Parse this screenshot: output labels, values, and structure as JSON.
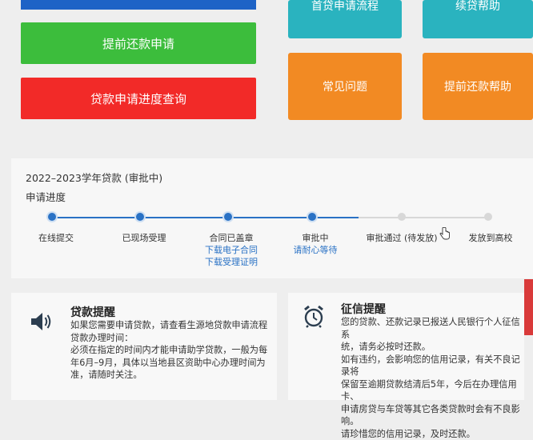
{
  "left_buttons": {
    "top_bar_color": "#1e63c6",
    "early_repay_apply": "提前还款申请",
    "early_repay_apply_color": "#3cbd3c",
    "loan_progress_query": "贷款申请进度查询",
    "loan_progress_query_color": "#f22a28"
  },
  "tiles": {
    "first_loan_flow": "首贷申请流程",
    "first_loan_flow_color": "#2ab3bf",
    "renew_help": "续贷帮助",
    "renew_help_color": "#2ab3bf",
    "faq": "常见问题",
    "faq_color": "#f28a23",
    "early_repay_help": "提前还款帮助",
    "early_repay_help_color": "#f28a23"
  },
  "progress": {
    "loan_title": "2022–2023学年贷款 (审批中)",
    "label": "申请进度",
    "steps": [
      {
        "label": "在线提交",
        "done": true
      },
      {
        "label": "已现场受理",
        "done": true
      },
      {
        "label": "合同已盖章",
        "done": true,
        "links": [
          "下载电子合同",
          "下载受理证明"
        ]
      },
      {
        "label": "审批中",
        "done": true,
        "links": [
          "请耐心等待"
        ]
      },
      {
        "label": "审批通过 (待发放)",
        "done": false
      },
      {
        "label": "发放到高校",
        "done": false
      }
    ],
    "active_color": "#2a72c5",
    "inactive_color": "#d8d8d8"
  },
  "loan_notice": {
    "title": "贷款提醒",
    "icon": "speaker-icon",
    "lines": [
      "如果您需要申请贷款，请查看生源地贷款申请流程",
      "贷款办理时间：",
      "必须在指定的时间内才能申请助学贷款，一般为每",
      "年6月–9月，具体以当地县区资助中心办理时间为",
      "准，请随时关注。"
    ]
  },
  "credit_notice": {
    "title": "征信提醒",
    "icon": "alarm-clock-icon",
    "lines": [
      "您的贷款、还款记录已报送人民银行个人征信系",
      "统，请务必按时还款。",
      "如有违约，会影响您的信用记录，有关不良记录将",
      "保留至逾期贷款结清后5年，今后在办理信用卡、",
      "申请房贷与车贷等其它各类贷款时会有不良影响。",
      "请珍惜您的信用记录，及时还款。"
    ]
  }
}
